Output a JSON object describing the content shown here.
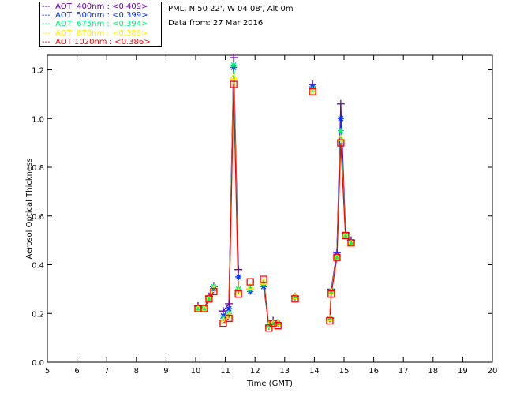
{
  "chart_data": {
    "type": "line",
    "title": "",
    "info_lines": [
      "PML, N 50 22', W 04 08', Alt 0m",
      "Data from: 27 Mar 2016"
    ],
    "xlabel": "Time (GMT)",
    "ylabel": "Aerosol Optical Thickness",
    "xlim": [
      5,
      20
    ],
    "ylim": [
      0,
      1.26
    ],
    "xticks": [
      5,
      6,
      7,
      8,
      9,
      10,
      11,
      12,
      13,
      14,
      15,
      16,
      17,
      18,
      19,
      20
    ],
    "yticks": [
      0.0,
      0.2,
      0.4,
      0.6,
      0.8,
      1.0,
      1.2
    ],
    "ytick_labels": [
      "0.0",
      "0.2",
      "0.4",
      "0.6",
      "0.8",
      "1.0",
      "1.2"
    ],
    "grid": false,
    "legend": "top-left",
    "x": [
      10.08,
      10.29,
      10.45,
      10.61,
      10.93,
      11.12,
      11.28,
      11.44,
      11.84,
      12.29,
      12.47,
      12.61,
      12.77,
      13.35,
      13.94,
      14.52,
      14.57,
      14.76,
      14.89,
      15.05,
      15.24
    ],
    "series": [
      {
        "name": "AOT  400nm : <0.409>",
        "legend_label": "AOT  400nm",
        "mean": "<0.409>",
        "color": "#6600aa",
        "marker": "plus",
        "values": [
          0.23,
          0.22,
          0.27,
          0.31,
          0.21,
          0.24,
          1.25,
          0.38,
          0.3,
          0.32,
          0.15,
          0.17,
          0.16,
          0.27,
          1.14,
          0.18,
          0.3,
          0.45,
          1.06,
          0.53,
          0.5
        ]
      },
      {
        "name": "AOT  500nm : <0.399>",
        "legend_label": "AOT  500nm",
        "mean": "<0.399>",
        "color": "#0033ff",
        "marker": "asterisk",
        "values": [
          0.22,
          0.22,
          0.26,
          0.3,
          0.19,
          0.22,
          1.21,
          0.35,
          0.29,
          0.31,
          0.15,
          0.16,
          0.16,
          0.27,
          1.13,
          0.18,
          0.29,
          0.44,
          1.0,
          0.52,
          0.49
        ]
      },
      {
        "name": "AOT  675nm : <0.394>",
        "legend_label": "AOT  675nm",
        "mean": "<0.394>",
        "color": "#00ee77",
        "marker": "asterisk",
        "values": [
          0.22,
          0.22,
          0.26,
          0.31,
          0.18,
          0.2,
          1.22,
          0.3,
          0.3,
          0.32,
          0.15,
          0.16,
          0.16,
          0.27,
          1.12,
          0.18,
          0.29,
          0.43,
          0.95,
          0.52,
          0.49
        ]
      },
      {
        "name": "AOT  870nm : <0.389>",
        "legend_label": "AOT  870nm",
        "mean": "<0.389>",
        "color": "#ffee00",
        "marker": "triangle",
        "values": [
          0.22,
          0.22,
          0.26,
          0.3,
          0.17,
          0.19,
          1.17,
          0.29,
          0.31,
          0.33,
          0.15,
          0.16,
          0.16,
          0.27,
          1.11,
          0.18,
          0.29,
          0.43,
          0.92,
          0.52,
          0.49
        ]
      },
      {
        "name": "AOT 1020nm : <0.386>",
        "legend_label": "AOT 1020nm",
        "mean": "<0.386>",
        "color": "#ff0000",
        "marker": "square",
        "values": [
          0.22,
          0.22,
          0.26,
          0.29,
          0.16,
          0.18,
          1.14,
          0.28,
          0.33,
          0.34,
          0.14,
          0.16,
          0.15,
          0.26,
          1.11,
          0.17,
          0.28,
          0.43,
          0.9,
          0.52,
          0.49
        ]
      }
    ]
  }
}
